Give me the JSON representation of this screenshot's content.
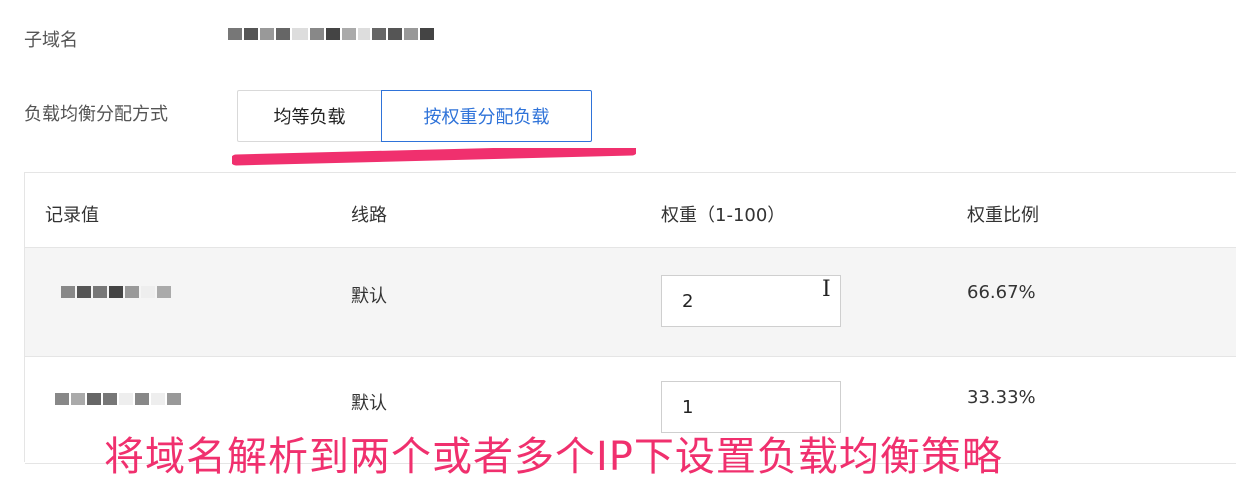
{
  "form": {
    "subdomain_label": "子域名",
    "lb_method_label": "负载均衡分配方式"
  },
  "segmented": {
    "equal": "均等负载",
    "weighted": "按权重分配负载",
    "selected": "weighted"
  },
  "table": {
    "headers": [
      "记录值",
      "线路",
      "权重（1-100）",
      "权重比例"
    ],
    "rows": [
      {
        "line": "默认",
        "weight": "2",
        "ratio": "66.67%"
      },
      {
        "line": "默认",
        "weight": "1",
        "ratio": "33.33%"
      }
    ]
  },
  "caption": "将域名解析到两个或者多个IP下设置负载均衡策略",
  "colors": {
    "accent": "#2f73d9",
    "annotation": "#f0306e"
  }
}
